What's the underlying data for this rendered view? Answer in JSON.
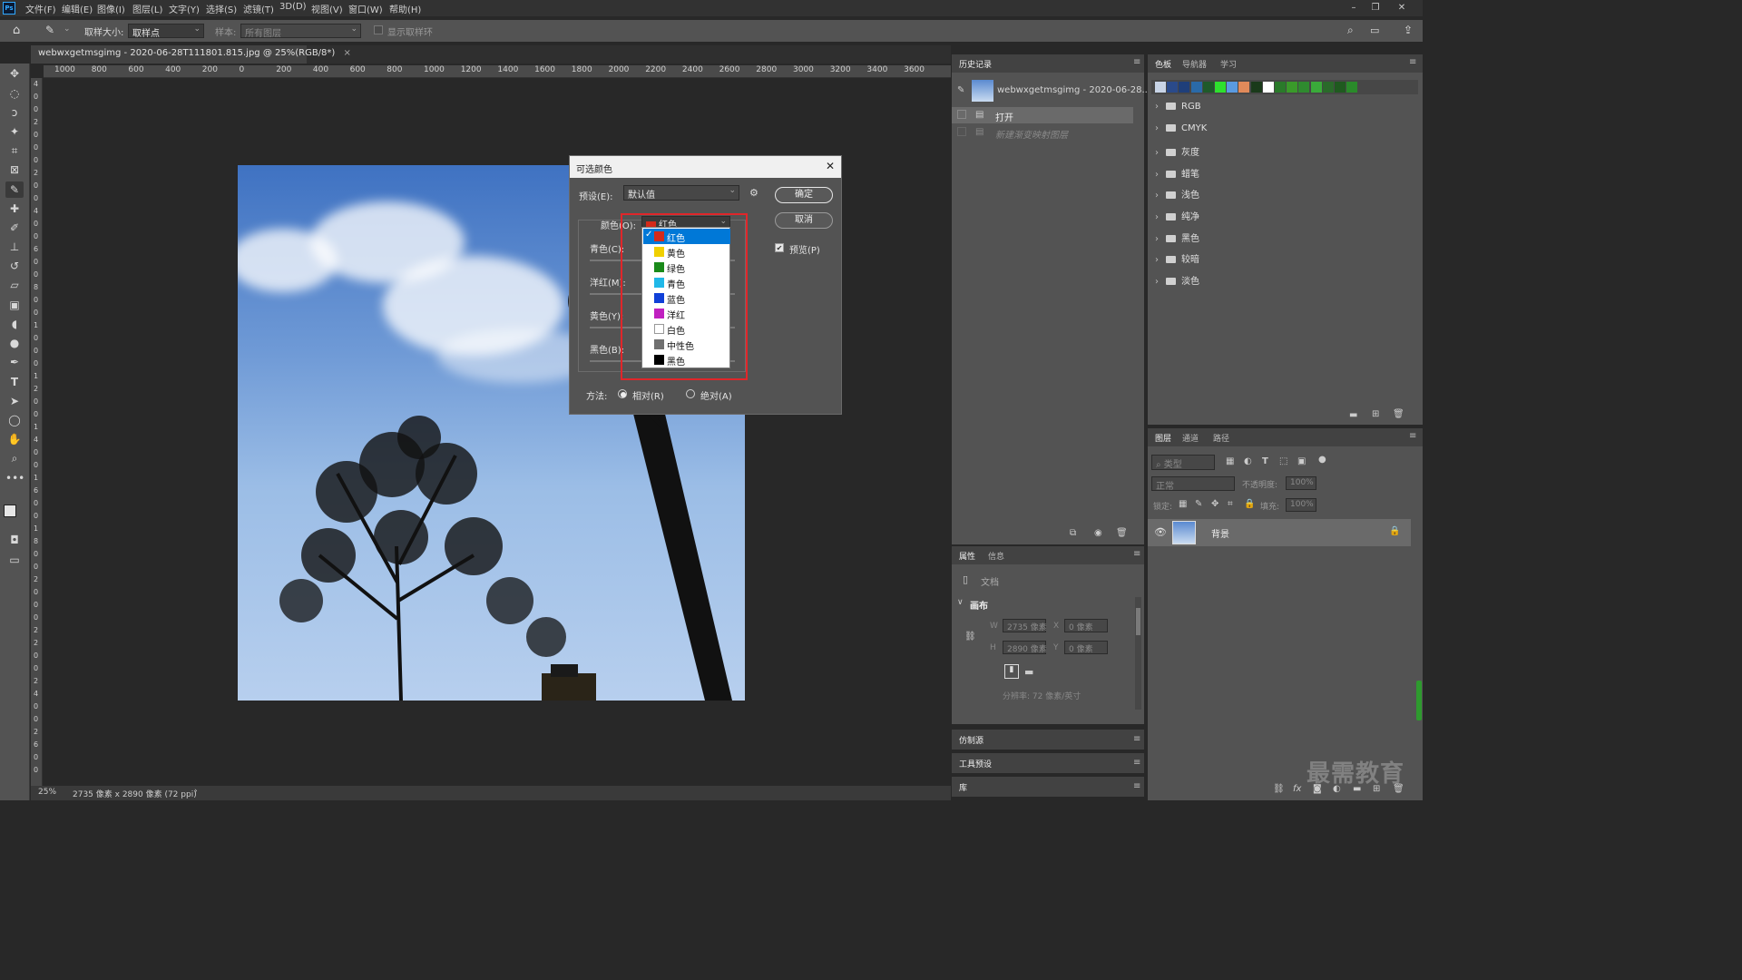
{
  "app": {
    "logo": "Ps"
  },
  "menu": [
    "文件(F)",
    "编辑(E)",
    "图像(I)",
    "图层(L)",
    "文字(Y)",
    "选择(S)",
    "滤镜(T)",
    "3D(D)",
    "视图(V)",
    "窗口(W)",
    "帮助(H)"
  ],
  "window_controls": {
    "minimize": "–",
    "restore": "❐",
    "close": "✕"
  },
  "options": {
    "sample_size_label": "取样大小:",
    "sample_size_value": "取样点",
    "sample_label": "样本:",
    "sample_value": "所有图层",
    "show_ring_label": "显示取样环"
  },
  "document": {
    "tab_title": "webwxgetmsgimg - 2020-06-28T111801.815.jpg @ 25%(RGB/8*)",
    "tab_close": "×",
    "zoom": "25%",
    "info": "2735 像素 x 2890 像素 (72 ppi)",
    "info_arrow": "›"
  },
  "ruler_h": [
    "1000",
    "800",
    "600",
    "400",
    "200",
    "0",
    "200",
    "400",
    "600",
    "800",
    "1000",
    "1200",
    "1400",
    "1600",
    "1800",
    "2000",
    "2200",
    "2400",
    "2600",
    "2800",
    "3000",
    "3200",
    "3400",
    "3600"
  ],
  "ruler_v": [
    "4",
    "0",
    "0",
    "2",
    "0",
    "0",
    "0",
    "2",
    "0",
    "0",
    "4",
    "0",
    "0",
    "6",
    "0",
    "0",
    "8",
    "0",
    "0",
    "1",
    "0",
    "0",
    "0",
    "1",
    "2",
    "0",
    "0",
    "1",
    "4",
    "0",
    "0",
    "1",
    "6",
    "0",
    "0",
    "1",
    "8",
    "0",
    "0",
    "2",
    "0",
    "0",
    "0",
    "2",
    "2",
    "0",
    "0",
    "2",
    "4",
    "0",
    "0",
    "2",
    "6",
    "0",
    "0"
  ],
  "history": {
    "tab": "历史记录",
    "snapshot": "webwxgetmsgimg - 2020-06-28...",
    "items": [
      "打开",
      "新建渐变映射图层"
    ]
  },
  "swatches_panel": {
    "tabs": [
      "色板",
      "导航器",
      "学习"
    ],
    "colors": [
      "#c8d4e6",
      "#2a4a8a",
      "#1f3f7a",
      "#2a6aa8",
      "#1f5a2a",
      "#2ee02e",
      "#5a9ae0",
      "#e08a5a",
      "#1a3a1a",
      "#ffffff",
      "#2a7a2a",
      "#3a9a2a",
      "#2f8a2f",
      "#3aaa3a",
      "#2a6a2a",
      "#1f5a1f",
      "#2a8a2a"
    ],
    "groups": [
      "RGB",
      "CMYK",
      "灰度",
      "蜡笔",
      "浅色",
      "纯净",
      "黑色",
      "较暗",
      "淡色"
    ]
  },
  "properties": {
    "tabs": [
      "属性",
      "信息"
    ],
    "doc_label": "文档",
    "section": "画布",
    "w_label": "W",
    "w_value": "2735 像素",
    "h_label": "H",
    "h_value": "2890 像素",
    "x_label": "X",
    "x_value": "0 像素",
    "y_label": "Y",
    "y_value": "0 像素",
    "resolution": "分辨率: 72 像素/英寸"
  },
  "collapsed_panels": [
    "仿制源",
    "工具预设",
    "库"
  ],
  "layers": {
    "tabs": [
      "图层",
      "通道",
      "路径"
    ],
    "filter_placeholder": "类型",
    "blend_mode": "正常",
    "opacity_label": "不透明度:",
    "opacity_value": "100%",
    "lock_label": "锁定:",
    "fill_label": "填充:",
    "fill_value": "100%",
    "items": [
      {
        "name": "背景"
      }
    ]
  },
  "dialog": {
    "title": "可选颜色",
    "preset_label": "预设(E):",
    "preset_value": "默认值",
    "ok": "确定",
    "cancel": "取消",
    "preview_label": "预览(P)",
    "colors_label": "颜色(O):",
    "colors_value": "红色",
    "sliders": [
      "青色(C):",
      "洋红(M):",
      "黄色(Y):",
      "黑色(B):"
    ],
    "method_label": "方法:",
    "method_relative": "相对(R)",
    "method_absolute": "绝对(A)",
    "options": [
      {
        "label": "红色",
        "color": "#d42a1a"
      },
      {
        "label": "黄色",
        "color": "#f0d000"
      },
      {
        "label": "绿色",
        "color": "#1a8a1a"
      },
      {
        "label": "青色",
        "color": "#20b8e8"
      },
      {
        "label": "蓝色",
        "color": "#1040d8"
      },
      {
        "label": "洋红",
        "color": "#c020c0"
      },
      {
        "label": "白色",
        "color": "#ffffff"
      },
      {
        "label": "中性色",
        "color": "#707070"
      },
      {
        "label": "黑色",
        "color": "#000000"
      }
    ],
    "selected_check": "✓"
  },
  "watermark": "最需教育"
}
